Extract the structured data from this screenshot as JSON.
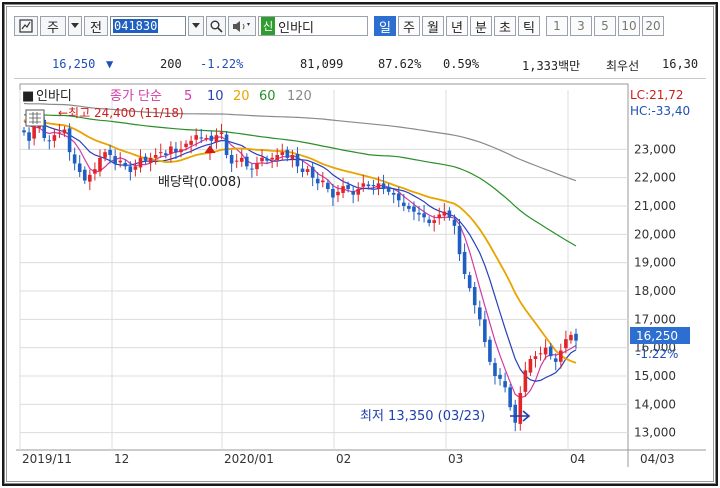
{
  "toolbar": {
    "type_label": "주",
    "mode_label": "전",
    "code_value": "041830",
    "new_badge": "신",
    "stock_name": "인바디",
    "periods": [
      "일",
      "주",
      "월",
      "년",
      "분",
      "초",
      "틱"
    ],
    "active_period": "일",
    "numbers": [
      "1",
      "3",
      "5",
      "10",
      "20"
    ]
  },
  "quote": {
    "price": "16,250",
    "change": "200",
    "change_pct": "-1.22%",
    "volume": "81,099",
    "volume_ratio": "87.62%",
    "turnover": "0.59%",
    "amount": "1,333백만",
    "bid_label": "최우선",
    "bid_price": "16,30"
  },
  "legend": {
    "name": "인바디",
    "ma_label": "종가 단순",
    "ma_periods": [
      "5",
      "10",
      "20",
      "60",
      "120"
    ],
    "ma_colors": [
      "#d23aa6",
      "#2740b8",
      "#e9a400",
      "#2a8f2a",
      "#8a8a8a"
    ]
  },
  "chart": {
    "high_label": "←최고 24,400 (11/18)",
    "low_label": "최저 13,350 (03/23)",
    "dividend_label": "배당락(0.008)",
    "lc_label": "LC:21,72",
    "hc_label": "HC:-33,40",
    "current_price_tag": "16,250",
    "current_pct_tag": "-1.22%",
    "y_ticks": [
      "23,000",
      "22,000",
      "21,000",
      "20,000",
      "19,000",
      "18,000",
      "17,000",
      "16,000",
      "15,000",
      "14,000",
      "13,000"
    ],
    "x_labels": [
      "2019/11",
      "12",
      "2020/01",
      "02",
      "03",
      "04",
      "04/03"
    ]
  },
  "chart_data": {
    "type": "candlestick",
    "title": "인바디",
    "ylim": [
      12600,
      24600
    ],
    "y_ticks": [
      23000,
      22000,
      21000,
      20000,
      19000,
      18000,
      17000,
      16000,
      15000,
      14000,
      13000
    ],
    "x_labels": [
      "2019/11",
      "12",
      "2020/01",
      "02",
      "03",
      "04"
    ],
    "close_series": [
      23600,
      23300,
      23800,
      24000,
      23400,
      23300,
      23500,
      23600,
      23700,
      22900,
      22500,
      22200,
      21900,
      22100,
      22300,
      22700,
      22900,
      22800,
      22500,
      22600,
      22400,
      22200,
      22400,
      22700,
      22600,
      22700,
      22800,
      22900,
      22800,
      23100,
      22900,
      23000,
      23200,
      23300,
      23500,
      23400,
      23400,
      23300,
      23500,
      23600,
      22800,
      22500,
      22600,
      22700,
      22400,
      22300,
      22500,
      22700,
      22600,
      22700,
      22800,
      22900,
      22700,
      22800,
      22400,
      22200,
      22300,
      22000,
      21800,
      21900,
      21600,
      21300,
      21500,
      21700,
      21600,
      21400,
      21600,
      21800,
      21700,
      21700,
      21800,
      21600,
      21500,
      21400,
      21200,
      21000,
      20900,
      20800,
      20700,
      20600,
      20400,
      20500,
      20700,
      20800,
      20600,
      20300,
      19300,
      18600,
      18100,
      17500,
      17000,
      16200,
      15500,
      15000,
      14900,
      14600,
      13900,
      13350,
      14400,
      15200,
      15600,
      15700,
      15800,
      16000,
      15700,
      15500,
      15900,
      16300,
      16450,
      16250
    ],
    "ma_lines": [
      {
        "name": "5",
        "values_note": "short moving average"
      },
      {
        "name": "10"
      },
      {
        "name": "20"
      },
      {
        "name": "60"
      },
      {
        "name": "120"
      }
    ],
    "annotations": [
      {
        "text": "최고 24,400 (11/18)",
        "value": 24400
      },
      {
        "text": "최저 13,350 (03/23)",
        "value": 13350
      },
      {
        "text": "배당락(0.008)"
      }
    ]
  }
}
